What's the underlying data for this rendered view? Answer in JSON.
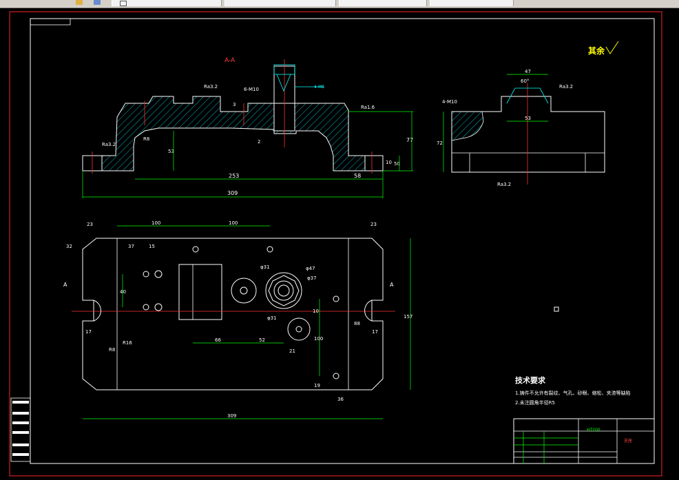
{
  "toolbar": {
    "tabs": [
      {
        "label": "",
        "id": "t1"
      },
      {
        "label": "",
        "id": "t2"
      },
      {
        "label": "",
        "id": "t3"
      },
      {
        "label": "",
        "id": "t4"
      }
    ]
  },
  "drawing": {
    "section_label": "A-A",
    "surface_rest": "其余",
    "view_label_left": "A",
    "view_label_right": "A",
    "ra": "Ra3.2",
    "ra_b": "Ra1.6",
    "holes_top": "4-M8",
    "holes_mid": "6-M10",
    "holes_side": "4-M10",
    "d_top_253": "253",
    "d_top_58": "58",
    "d_top_309": "309",
    "d_top_77": "77",
    "d_top_10": "10",
    "d_top_50": "50",
    "d_top_R8": "R8",
    "d_top_53": "53",
    "d_top_3": "3",
    "d_top_2": "2",
    "d_side_47": "47",
    "d_side_53": "53",
    "d_side_72": "72",
    "d_side_60": "60°",
    "d_plan_23": "23",
    "d_plan_100a": "100",
    "d_plan_100b": "100",
    "d_plan_37": "37",
    "d_plan_15": "15",
    "d_plan_32": "32",
    "d_plan_40": "40",
    "d_plan_66": "66",
    "d_plan_52": "52",
    "d_plan_21": "21",
    "d_plan_17": "17",
    "d_plan_309": "309",
    "d_plan_157": "157",
    "d_plan_R16": "R16",
    "d_plan_R8": "R8",
    "d_plan_phi31": "φ31",
    "d_plan_phi47": "φ47",
    "d_plan_phi37": "φ37",
    "d_plan_phi31b": "φ31",
    "d_plan_100c": "100",
    "d_plan_10": "10",
    "d_plan_19": "19",
    "d_plan_88": "88",
    "d_plan_36": "36",
    "tech_title": "技术要求",
    "tech_line1": "1.铸件不允许有裂纹、气孔、砂眼、缩松、夹渣等缺陷",
    "tech_line2": "2.未注圆角半径R5",
    "title_material": "HT200",
    "title_name": "支座"
  }
}
